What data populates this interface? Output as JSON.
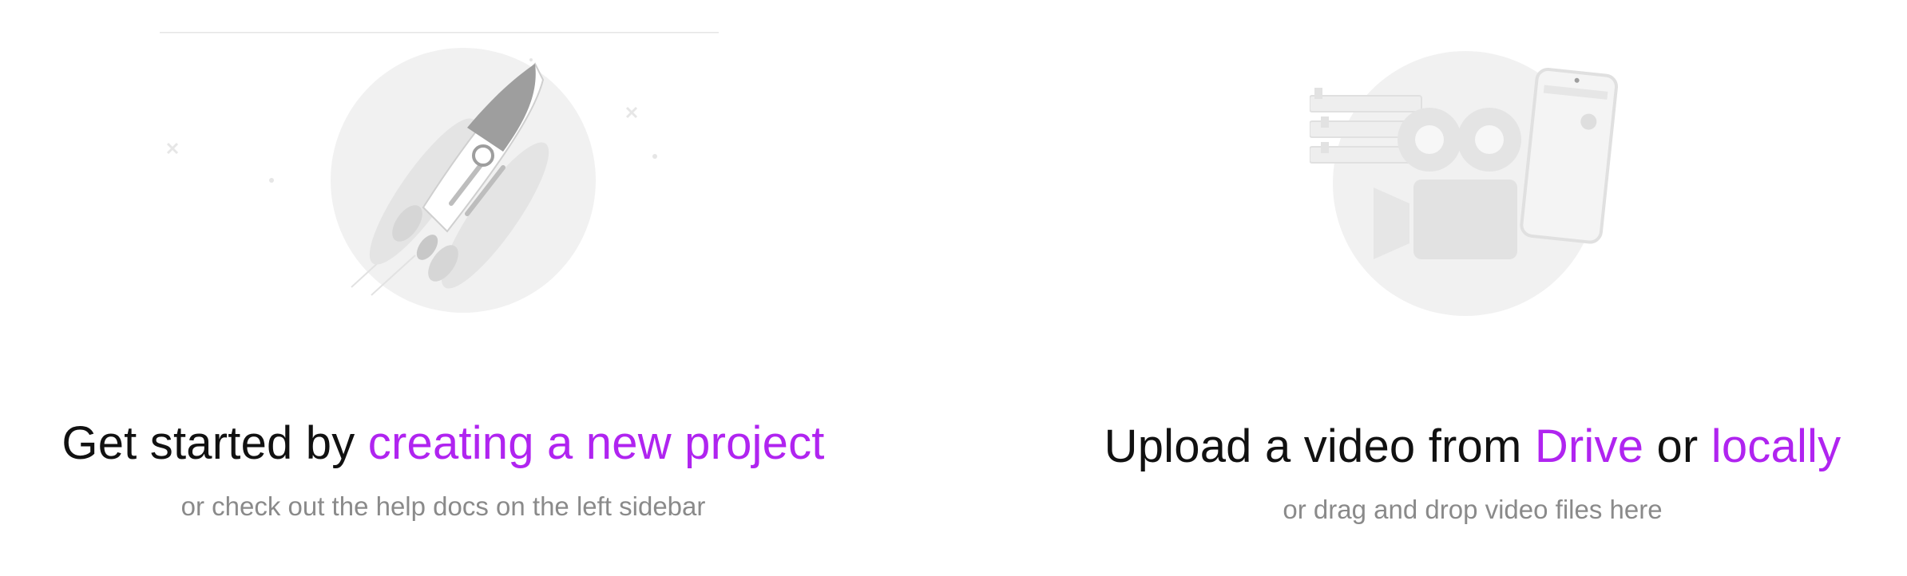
{
  "left_panel": {
    "illustration": "rocket-launch-illustration",
    "headline_prefix": "Get started by ",
    "headline_link": "creating a new project",
    "subline": "or check out the help docs on the left sidebar"
  },
  "right_panel": {
    "illustration": "video-camera-upload-illustration",
    "headline_prefix": "Upload a video from ",
    "headline_link_drive": "Drive",
    "headline_middle": " or ",
    "headline_link_local": "locally",
    "subline": "or drag and drop video files here"
  },
  "colors": {
    "link": "#b024f0",
    "headline": "#111111",
    "subline": "#8a8a8a",
    "illustration_bg": "#f1f1f1"
  }
}
